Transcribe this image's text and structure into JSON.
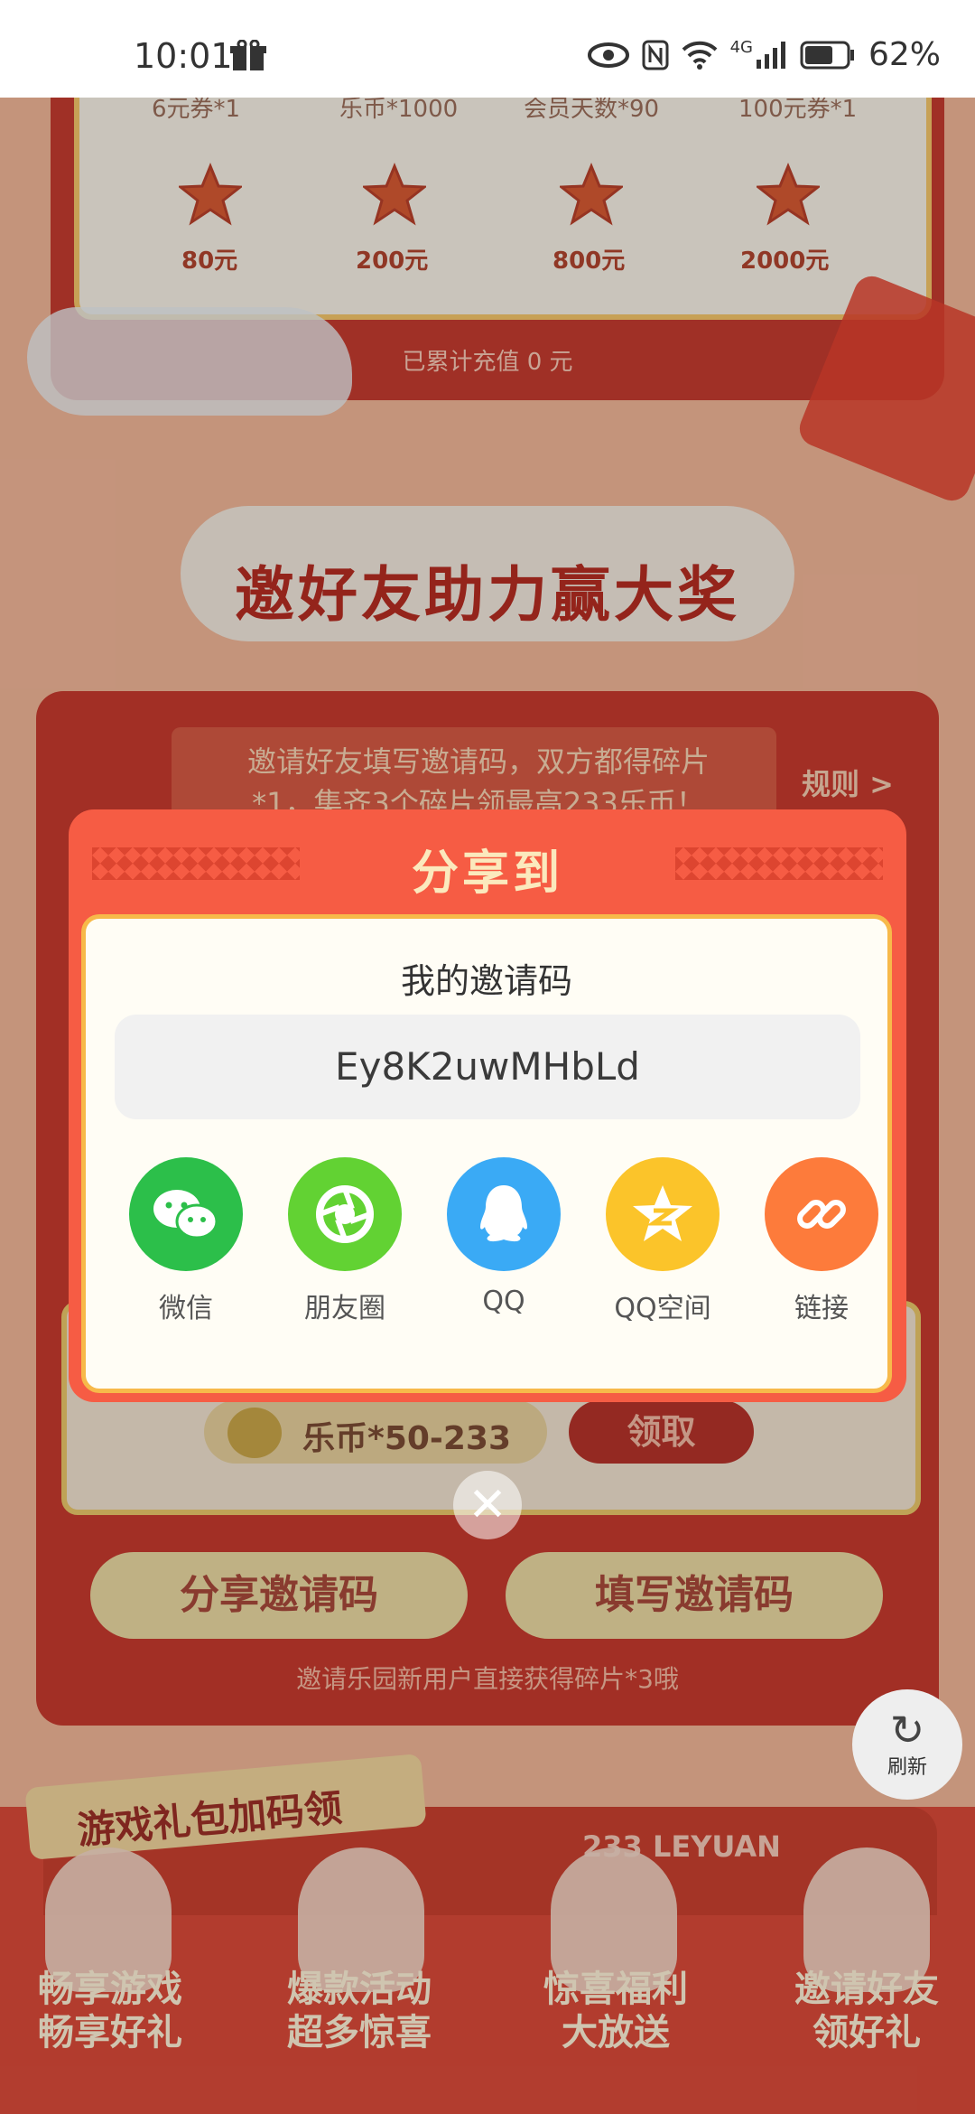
{
  "status_bar": {
    "time": "10:01",
    "network": "4G",
    "battery": "62%"
  },
  "milestones": {
    "rewards": [
      "6元券*1",
      "乐币*1000",
      "会员天数*90",
      "100元券*1"
    ],
    "amounts": [
      "80元",
      "200元",
      "800元",
      "2000元"
    ],
    "accumulated": "已累计充值 0 元"
  },
  "section": {
    "title": "邀好友助力赢大奖",
    "notice_line1": "邀请好友填写邀请码，双方都得碎片",
    "notice_line2": "*1，集齐3个碎片领最高233乐币！",
    "rules_link": "规则 >",
    "reward_text": "乐币*50-233",
    "claim_button": "领取",
    "share_code_button": "分享邀请码",
    "fill_code_button": "填写邀请码",
    "hint": "邀请乐园新用户直接获得碎片*3哦"
  },
  "refresh": {
    "label": "刷新"
  },
  "bottom": {
    "package_label": "游戏礼包加码领",
    "brand": "233 LEYUAN",
    "promos": [
      {
        "line1": "畅享游戏",
        "line2": "畅享好礼"
      },
      {
        "line1": "爆款活动",
        "line2": "超多惊喜"
      },
      {
        "line1": "惊喜福利",
        "line2": "大放送"
      },
      {
        "line1": "邀请好友",
        "line2": "领好礼"
      }
    ]
  },
  "modal": {
    "title": "分享到",
    "code_label": "我的邀请码",
    "invite_code": "Ey8K2uwMHbLd",
    "targets": [
      {
        "label": "微信",
        "icon": "wechat-icon",
        "color": "#2cbf4a"
      },
      {
        "label": "朋友圈",
        "icon": "moments-icon",
        "color": "#62d233"
      },
      {
        "label": "QQ",
        "icon": "qq-icon",
        "color": "#3aaaf5"
      },
      {
        "label": "QQ空间",
        "icon": "qzone-icon",
        "color": "#fbc42a"
      },
      {
        "label": "链接",
        "icon": "link-icon",
        "color": "#fd7b3b"
      }
    ]
  }
}
